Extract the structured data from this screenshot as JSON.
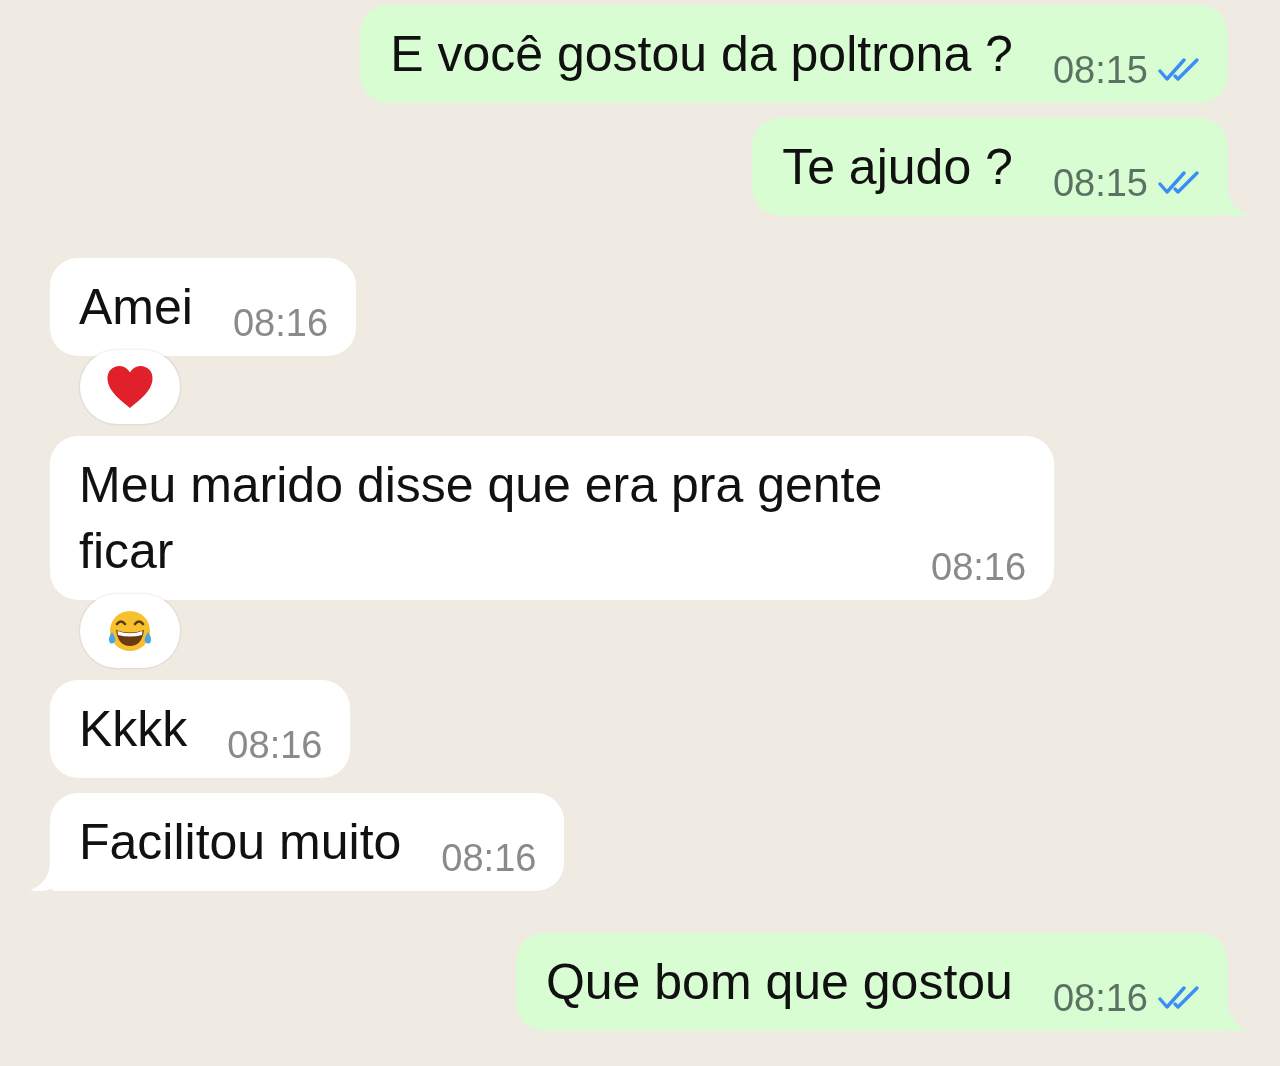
{
  "messages": [
    {
      "kind": "outgoing",
      "text": "E você gostou da poltrona ?",
      "time": "08:15",
      "read": true
    },
    {
      "kind": "outgoing",
      "text": "Te ajudo ?",
      "time": "08:15",
      "read": true
    },
    {
      "kind": "incoming",
      "text": "Amei",
      "time": "08:16",
      "reaction": {
        "kind": "heart"
      }
    },
    {
      "kind": "incoming",
      "text": "Meu marido disse que era pra gente ficar",
      "time": "08:16",
      "reaction": {
        "kind": "laughing"
      }
    },
    {
      "kind": "incoming",
      "text": "Kkkk",
      "time": "08:16"
    },
    {
      "kind": "incoming",
      "text": "Facilitou muito",
      "time": "08:16"
    },
    {
      "kind": "outgoing",
      "text": "Que bom que gostou",
      "time": "08:16",
      "read": true
    }
  ]
}
